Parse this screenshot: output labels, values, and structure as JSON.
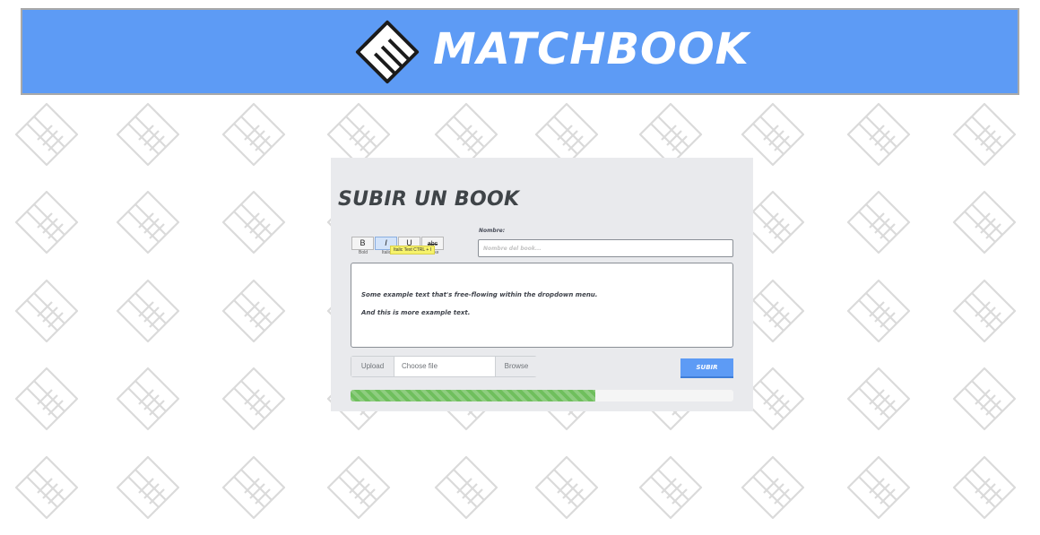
{
  "header": {
    "brand": "MATCHBOOK",
    "logo_icon": "matchbook-logo-icon",
    "background_color": "#5d9bf5"
  },
  "panel": {
    "title": "SUBIR UN BOOK"
  },
  "toolbar": {
    "buttons": [
      {
        "label": "B",
        "caption": "Bold",
        "icon": "bold-icon"
      },
      {
        "label": "I",
        "caption": "Italic",
        "icon": "italic-icon",
        "active": true
      },
      {
        "label": "U",
        "caption": "Underline",
        "icon": "underline-icon"
      },
      {
        "label": "abc",
        "caption": "Strike",
        "icon": "strikethrough-icon"
      }
    ],
    "tooltip": "Italic Text CTRL + I"
  },
  "name_field": {
    "label": "Nombre:",
    "placeholder": "Nombre del book..."
  },
  "editor": {
    "lines": [
      "Some example text that's free-flowing within the dropdown menu.",
      "And this is more example text."
    ]
  },
  "upload": {
    "label": "Upload",
    "placeholder": "Choose file",
    "browse_label": "Browse"
  },
  "submit": {
    "label": "SUBIR"
  },
  "progress": {
    "percent": 64,
    "color": "#6fbf5d"
  }
}
